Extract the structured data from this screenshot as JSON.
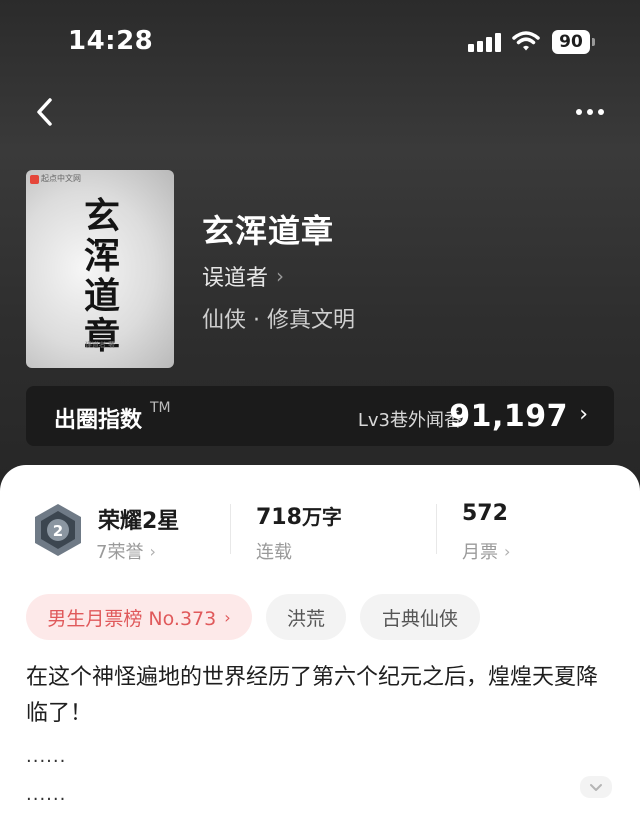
{
  "status_bar": {
    "time": "14:28",
    "battery": "90"
  },
  "book": {
    "title": "玄浑道章",
    "author": "误道者",
    "genre": "仙侠 · 修真文明",
    "cover": {
      "brand": "起点中文网",
      "title_chars": [
        "玄",
        "浑",
        "道",
        "章"
      ],
      "author": "误道者 著"
    }
  },
  "index_bar": {
    "title": "出圈指数",
    "tm": "TM",
    "level": "Lv3巷外闻香",
    "value": "91,197"
  },
  "stats": {
    "honor": {
      "title": "荣耀2星",
      "sub": "7荣誉",
      "medal_digit": "2"
    },
    "words": {
      "number": "718",
      "unit": "万字",
      "sub": "连载"
    },
    "tickets": {
      "number": "572",
      "sub": "月票"
    }
  },
  "tags": [
    "男生月票榜 No.373",
    "洪荒",
    "古典仙侠"
  ],
  "description": {
    "text": "在这个神怪遍地的世界经历了第六个纪元之后，煌煌天夏降临了！",
    "ellipsis_1": "......",
    "ellipsis_2": "......"
  },
  "icons": [
    "back-icon",
    "more-icon",
    "chevron-right-icon",
    "medal-icon",
    "signal-icon",
    "wifi-icon",
    "battery-icon",
    "chevron-down-icon"
  ],
  "colors": {
    "hero_bg": "#2b2b2b",
    "index_bg": "#1b1b1b",
    "rank_tag_bg": "#fde9e9",
    "rank_tag_text": "#e0595b"
  }
}
